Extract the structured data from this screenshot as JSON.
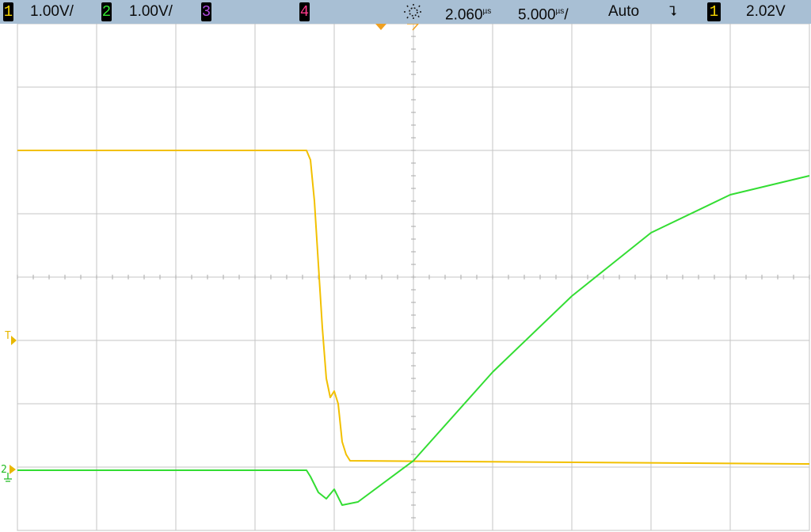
{
  "status_bar": {
    "ch1": {
      "num": "1",
      "scale": "1.00V/",
      "color": "#f5d400"
    },
    "ch2": {
      "num": "2",
      "scale": "1.00V/",
      "color": "#33e833"
    },
    "ch3": {
      "num": "3",
      "color": "#b04ae0"
    },
    "ch4": {
      "num": "4",
      "color": "#ff3a8c"
    },
    "acquire_icon": "run-sun-icon",
    "time_delay": "2.060",
    "time_delay_unit": "µs",
    "time_scale": "5.000",
    "time_scale_unit": "µs",
    "trigger_mode": "Auto",
    "trigger_slope_glyph": "⮧",
    "trigger_source": "1",
    "trigger_level": "2.02V"
  },
  "graticule": {
    "divisions_x": 10,
    "divisions_y": 8,
    "color": "#c4c4c4"
  },
  "markers": {
    "trigger_level_marker": "T",
    "ch2_ground_marker": "2"
  },
  "chart_data": {
    "type": "line",
    "x_unit": "µs",
    "x_range_div": [
      -5,
      5
    ],
    "series": [
      {
        "color": "#f2c000",
        "points": [
          [
            -5.0,
            2.0
          ],
          [
            -1.35,
            2.0
          ],
          [
            -1.3,
            1.85
          ],
          [
            -1.25,
            1.2
          ],
          [
            -1.2,
            0.2
          ],
          [
            -1.15,
            -0.8
          ],
          [
            -1.1,
            -1.6
          ],
          [
            -1.05,
            -1.9
          ],
          [
            -1.0,
            -1.8
          ],
          [
            -0.95,
            -2.0
          ],
          [
            -0.9,
            -2.6
          ],
          [
            -0.85,
            -2.8
          ],
          [
            -0.8,
            -2.9
          ],
          [
            5.0,
            -2.95
          ]
        ]
      },
      {
        "color": "#33dd33",
        "points": [
          [
            -5.0,
            -3.05
          ],
          [
            -1.35,
            -3.05
          ],
          [
            -1.3,
            -3.15
          ],
          [
            -1.2,
            -3.4
          ],
          [
            -1.1,
            -3.5
          ],
          [
            -1.0,
            -3.35
          ],
          [
            -0.9,
            -3.6
          ],
          [
            -0.7,
            -3.55
          ],
          [
            0.0,
            -2.9
          ],
          [
            1.0,
            -1.5
          ],
          [
            2.0,
            -0.3
          ],
          [
            3.0,
            0.7
          ],
          [
            4.0,
            1.3
          ],
          [
            5.0,
            1.6
          ]
        ]
      }
    ]
  }
}
